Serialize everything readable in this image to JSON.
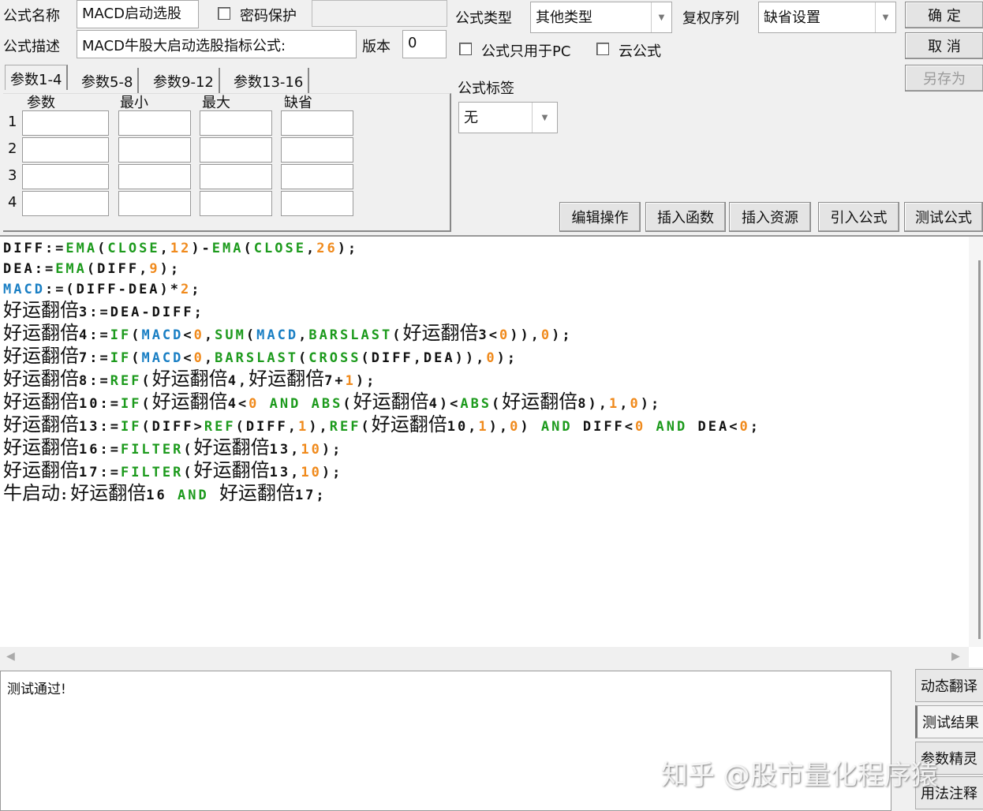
{
  "form": {
    "name_label": "公式名称",
    "name_value": "MACD启动选股",
    "password_label": "密码保护",
    "desc_label": "公式描述",
    "desc_value": "MACD牛股大启动选股指标公式:",
    "version_label": "版本",
    "version_value": "0",
    "type_label": "公式类型",
    "type_value": "其他类型",
    "rights_label": "复权序列",
    "rights_value": "缺省设置",
    "pc_only_label": "公式只用于PC",
    "cloud_label": "云公式",
    "tag_label": "公式标签",
    "tag_value": "无"
  },
  "buttons": {
    "ok": "确 定",
    "cancel": "取 消",
    "save_as": "另存为"
  },
  "tabs": [
    "参数1-4",
    "参数5-8",
    "参数9-12",
    "参数13-16"
  ],
  "params": {
    "headers": [
      "参数",
      "最小",
      "最大",
      "缺省"
    ],
    "rows": [
      "1",
      "2",
      "3",
      "4"
    ]
  },
  "toolbar": [
    "编辑操作",
    "插入函数",
    "插入资源",
    "引入公式",
    "测试公式"
  ],
  "code": [
    [
      [
        "DIFF:=",
        "d"
      ],
      [
        "EMA",
        "f"
      ],
      [
        "(",
        "d"
      ],
      [
        "CLOSE",
        "f"
      ],
      [
        ",",
        "d"
      ],
      [
        "12",
        "n"
      ],
      [
        ")-",
        "d"
      ],
      [
        "EMA",
        "f"
      ],
      [
        "(",
        "d"
      ],
      [
        "CLOSE",
        "f"
      ],
      [
        ",",
        "d"
      ],
      [
        "26",
        "n"
      ],
      [
        ");",
        "d"
      ]
    ],
    [
      [
        "DEA:=",
        "d"
      ],
      [
        "EMA",
        "f"
      ],
      [
        "(DIFF,",
        "d"
      ],
      [
        "9",
        "n"
      ],
      [
        ");",
        "d"
      ]
    ],
    [
      [
        "MACD",
        "v"
      ],
      [
        ":=(DIFF-DEA)*",
        "d"
      ],
      [
        "2",
        "n"
      ],
      [
        ";",
        "d"
      ]
    ],
    [
      [
        "好运翻倍",
        "c"
      ],
      [
        "3:=DEA-DIFF;",
        "d"
      ]
    ],
    [
      [
        "好运翻倍",
        "c"
      ],
      [
        "4:=",
        "d"
      ],
      [
        "IF",
        "f"
      ],
      [
        "(",
        "d"
      ],
      [
        "MACD",
        "v"
      ],
      [
        "<",
        "d"
      ],
      [
        "0",
        "n"
      ],
      [
        ",",
        "d"
      ],
      [
        "SUM",
        "f"
      ],
      [
        "(",
        "d"
      ],
      [
        "MACD",
        "v"
      ],
      [
        ",",
        "d"
      ],
      [
        "BARSLAST",
        "f"
      ],
      [
        "(",
        "d"
      ],
      [
        "好运翻倍",
        "c"
      ],
      [
        "3<",
        "d"
      ],
      [
        "0",
        "n"
      ],
      [
        ")),",
        "d"
      ],
      [
        "0",
        "n"
      ],
      [
        ");",
        "d"
      ]
    ],
    [
      [
        "好运翻倍",
        "c"
      ],
      [
        "7:=",
        "d"
      ],
      [
        "IF",
        "f"
      ],
      [
        "(",
        "d"
      ],
      [
        "MACD",
        "v"
      ],
      [
        "<",
        "d"
      ],
      [
        "0",
        "n"
      ],
      [
        ",",
        "d"
      ],
      [
        "BARSLAST",
        "f"
      ],
      [
        "(",
        "d"
      ],
      [
        "CROSS",
        "f"
      ],
      [
        "(DIFF,DEA)),",
        "d"
      ],
      [
        "0",
        "n"
      ],
      [
        ");",
        "d"
      ]
    ],
    [
      [
        "好运翻倍",
        "c"
      ],
      [
        "8:=",
        "d"
      ],
      [
        "REF",
        "f"
      ],
      [
        "(",
        "d"
      ],
      [
        "好运翻倍",
        "c"
      ],
      [
        "4,",
        "d"
      ],
      [
        "好运翻倍",
        "c"
      ],
      [
        "7+",
        "d"
      ],
      [
        "1",
        "n"
      ],
      [
        ");",
        "d"
      ]
    ],
    [
      [
        "好运翻倍",
        "c"
      ],
      [
        "10:=",
        "d"
      ],
      [
        "IF",
        "f"
      ],
      [
        "(",
        "d"
      ],
      [
        "好运翻倍",
        "c"
      ],
      [
        "4<",
        "d"
      ],
      [
        "0",
        "n"
      ],
      [
        " ",
        "d"
      ],
      [
        "AND",
        "f"
      ],
      [
        " ",
        "d"
      ],
      [
        "ABS",
        "f"
      ],
      [
        "(",
        "d"
      ],
      [
        "好运翻倍",
        "c"
      ],
      [
        "4)<",
        "d"
      ],
      [
        "ABS",
        "f"
      ],
      [
        "(",
        "d"
      ],
      [
        "好运翻倍",
        "c"
      ],
      [
        "8),",
        "d"
      ],
      [
        "1",
        "n"
      ],
      [
        ",",
        "d"
      ],
      [
        "0",
        "n"
      ],
      [
        ");",
        "d"
      ]
    ],
    [
      [
        "好运翻倍",
        "c"
      ],
      [
        "13:=",
        "d"
      ],
      [
        "IF",
        "f"
      ],
      [
        "(DIFF>",
        "d"
      ],
      [
        "REF",
        "f"
      ],
      [
        "(DIFF,",
        "d"
      ],
      [
        "1",
        "n"
      ],
      [
        "),",
        "d"
      ],
      [
        "REF",
        "f"
      ],
      [
        "(",
        "d"
      ],
      [
        "好运翻倍",
        "c"
      ],
      [
        "10,",
        "d"
      ],
      [
        "1",
        "n"
      ],
      [
        "),",
        "d"
      ],
      [
        "0",
        "n"
      ],
      [
        ") ",
        "d"
      ],
      [
        "AND",
        "f"
      ],
      [
        " DIFF<",
        "d"
      ],
      [
        "0",
        "n"
      ],
      [
        " ",
        "d"
      ],
      [
        "AND",
        "f"
      ],
      [
        " DEA<",
        "d"
      ],
      [
        "0",
        "n"
      ],
      [
        ";",
        "d"
      ]
    ],
    [
      [
        "好运翻倍",
        "c"
      ],
      [
        "16:=",
        "d"
      ],
      [
        "FILTER",
        "f"
      ],
      [
        "(",
        "d"
      ],
      [
        "好运翻倍",
        "c"
      ],
      [
        "13,",
        "d"
      ],
      [
        "10",
        "n"
      ],
      [
        ");",
        "d"
      ]
    ],
    [
      [
        "好运翻倍",
        "c"
      ],
      [
        "17:=",
        "d"
      ],
      [
        "FILTER",
        "f"
      ],
      [
        "(",
        "d"
      ],
      [
        "好运翻倍",
        "c"
      ],
      [
        "13,",
        "d"
      ],
      [
        "10",
        "n"
      ],
      [
        ");",
        "d"
      ]
    ],
    [
      [
        "牛启动",
        "c"
      ],
      [
        ":",
        "d"
      ],
      [
        "好运翻倍",
        "c"
      ],
      [
        "16 ",
        "d"
      ],
      [
        "AND",
        "f"
      ],
      [
        " ",
        "d"
      ],
      [
        "好运翻倍",
        "c"
      ],
      [
        "17;",
        "d"
      ]
    ]
  ],
  "output": {
    "text": "测试通过!"
  },
  "side_buttons": [
    "动态翻译",
    "测试结果",
    "参数精灵",
    "用法注释"
  ],
  "watermark": "知乎 @股市量化程序猿"
}
